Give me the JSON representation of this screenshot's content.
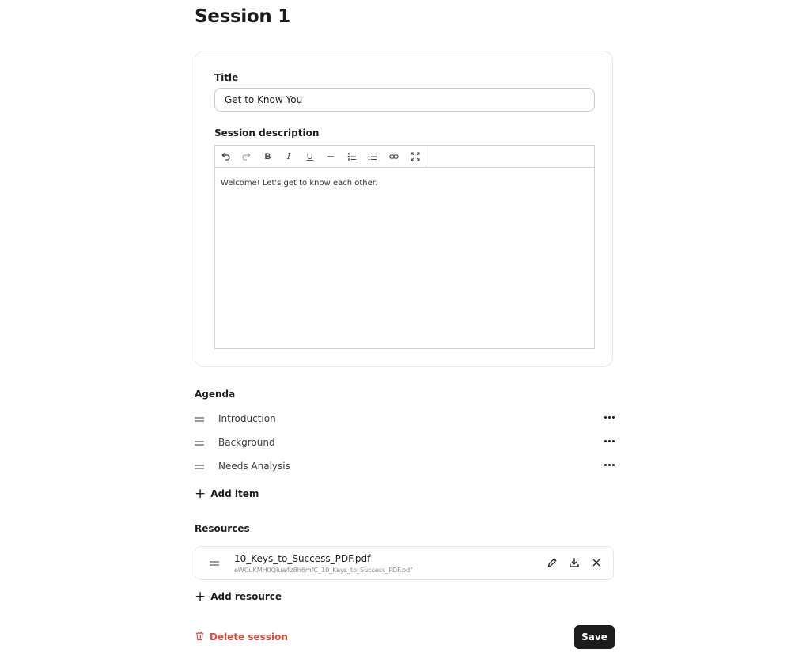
{
  "page": {
    "title": "Session 1"
  },
  "form": {
    "title_label": "Title",
    "title_value": "Get to Know You",
    "description_label": "Session description",
    "description_text": "Welcome! Let's get to know each other.",
    "toolbar": [
      "undo-icon",
      "redo-icon",
      "bold-icon",
      "italic-icon",
      "underline-icon",
      "horizontal-rule-icon",
      "ordered-list-icon",
      "bullet-list-icon",
      "link-icon",
      "fullscreen-icon"
    ]
  },
  "agenda": {
    "heading": "Agenda",
    "items": [
      {
        "label": "Introduction"
      },
      {
        "label": "Background"
      },
      {
        "label": "Needs Analysis"
      }
    ],
    "add_label": "Add item"
  },
  "resources": {
    "heading": "Resources",
    "items": [
      {
        "name": "10_Keys_to_Success_PDF.pdf",
        "id": "eWCuKMH0QIua4z8h6mfC_10_Keys_to_Success_PDF.pdf"
      }
    ],
    "add_label": "Add resource"
  },
  "footer": {
    "delete_label": "Delete session",
    "save_label": "Save"
  },
  "colors": {
    "danger": "#d94b3f",
    "primary": "#1c1c1e"
  }
}
